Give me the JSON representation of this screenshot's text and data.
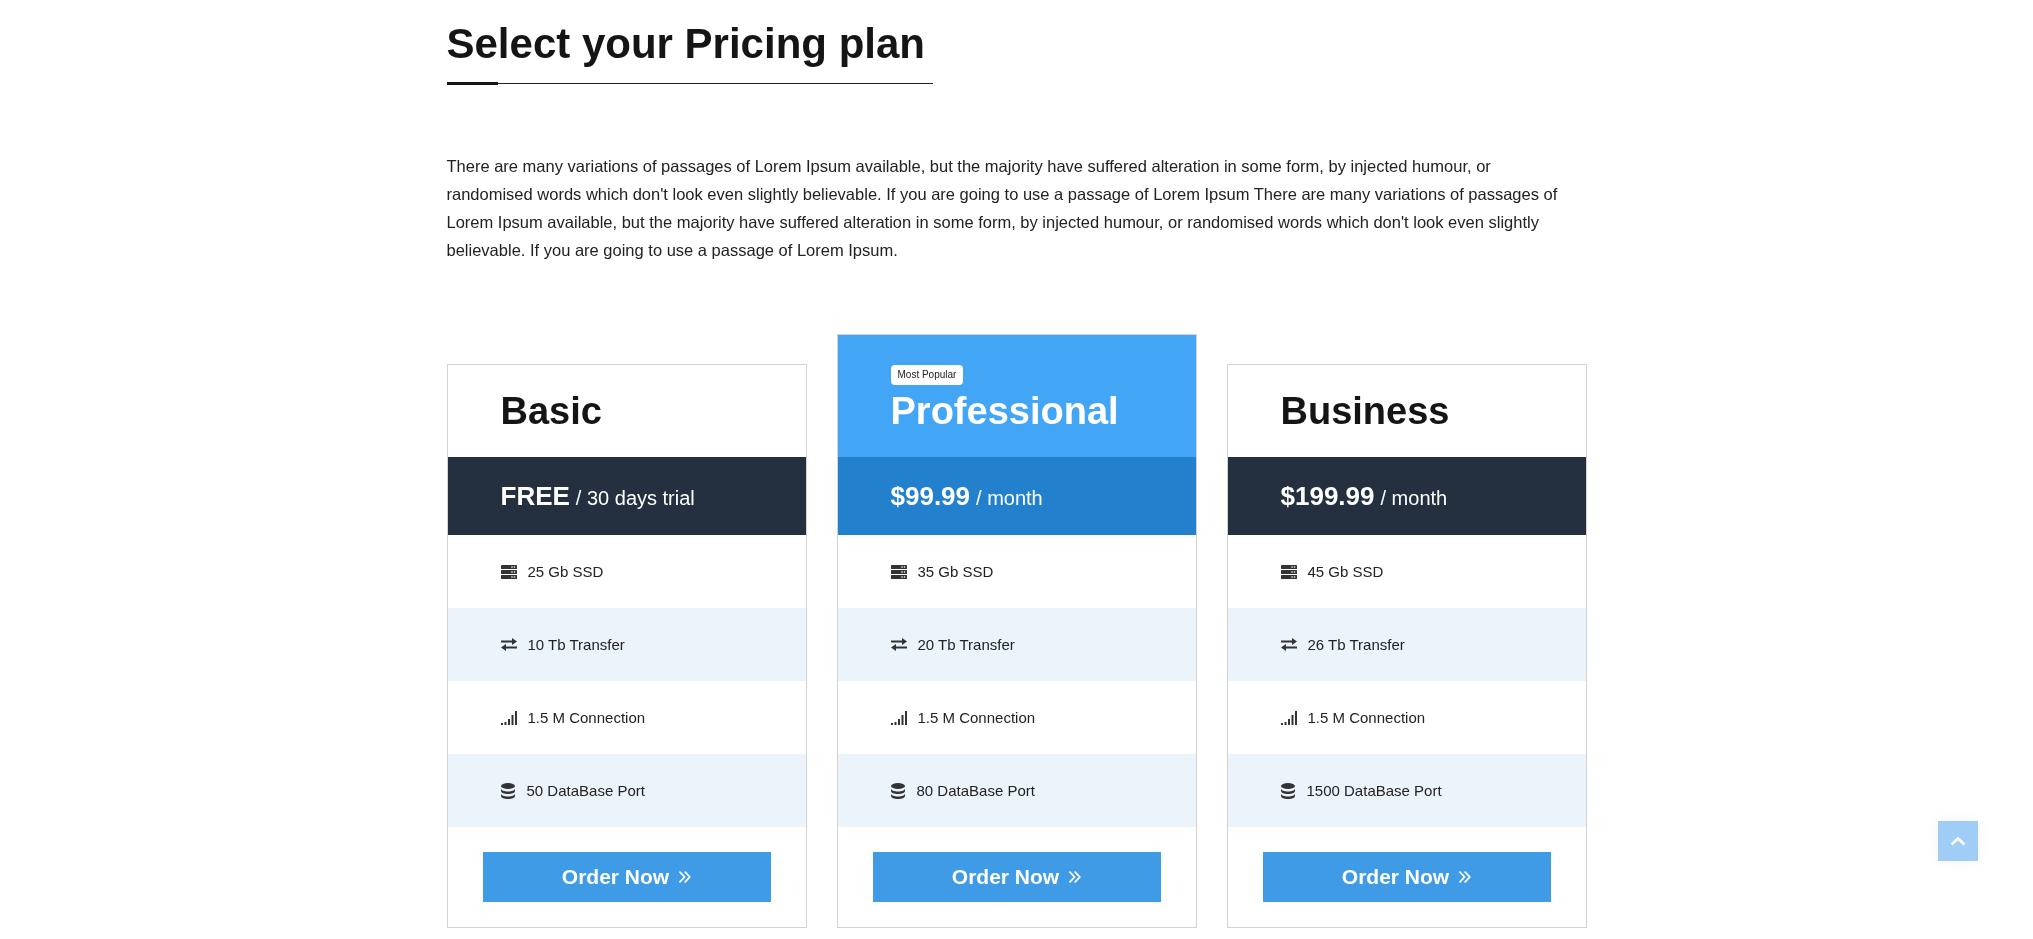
{
  "heading": {
    "title": "Select your Pricing plan"
  },
  "intro": "There are many variations of passages of Lorem Ipsum available, but the majority have suffered alteration in some form, by injected humour, or randomised words which don't look even slightly believable. If you are going to use a passage of Lorem Ipsum There are many variations of passages of Lorem Ipsum available, but the majority have suffered alteration in some form, by injected humour, or randomised words which don't look even slightly believable. If you are going to use a passage of Lorem Ipsum.",
  "plans": [
    {
      "name": "Basic",
      "featured": false,
      "price": "FREE",
      "period": "/ 30 days trial",
      "features": [
        {
          "kind": "storage",
          "text": "25 Gb SSD"
        },
        {
          "kind": "transfer",
          "text": "10 Tb Transfer"
        },
        {
          "kind": "connection",
          "text": "1.5 M Connection"
        },
        {
          "kind": "database",
          "text": "50 DataBase Port"
        }
      ],
      "button": "Order Now"
    },
    {
      "name": "Professional",
      "featured": true,
      "badge": "Most Popular",
      "price": "$99.99",
      "period": "/ month",
      "features": [
        {
          "kind": "storage",
          "text": "35 Gb SSD"
        },
        {
          "kind": "transfer",
          "text": "20 Tb Transfer"
        },
        {
          "kind": "connection",
          "text": "1.5 M Connection"
        },
        {
          "kind": "database",
          "text": "80 DataBase Port"
        }
      ],
      "button": "Order Now"
    },
    {
      "name": "Business",
      "featured": false,
      "price": "$199.99",
      "period": "/ month",
      "features": [
        {
          "kind": "storage",
          "text": "45 Gb SSD"
        },
        {
          "kind": "transfer",
          "text": "26 Tb Transfer"
        },
        {
          "kind": "connection",
          "text": "1.5 M Connection"
        },
        {
          "kind": "database",
          "text": "1500 DataBase Port"
        }
      ],
      "button": "Order Now"
    }
  ]
}
